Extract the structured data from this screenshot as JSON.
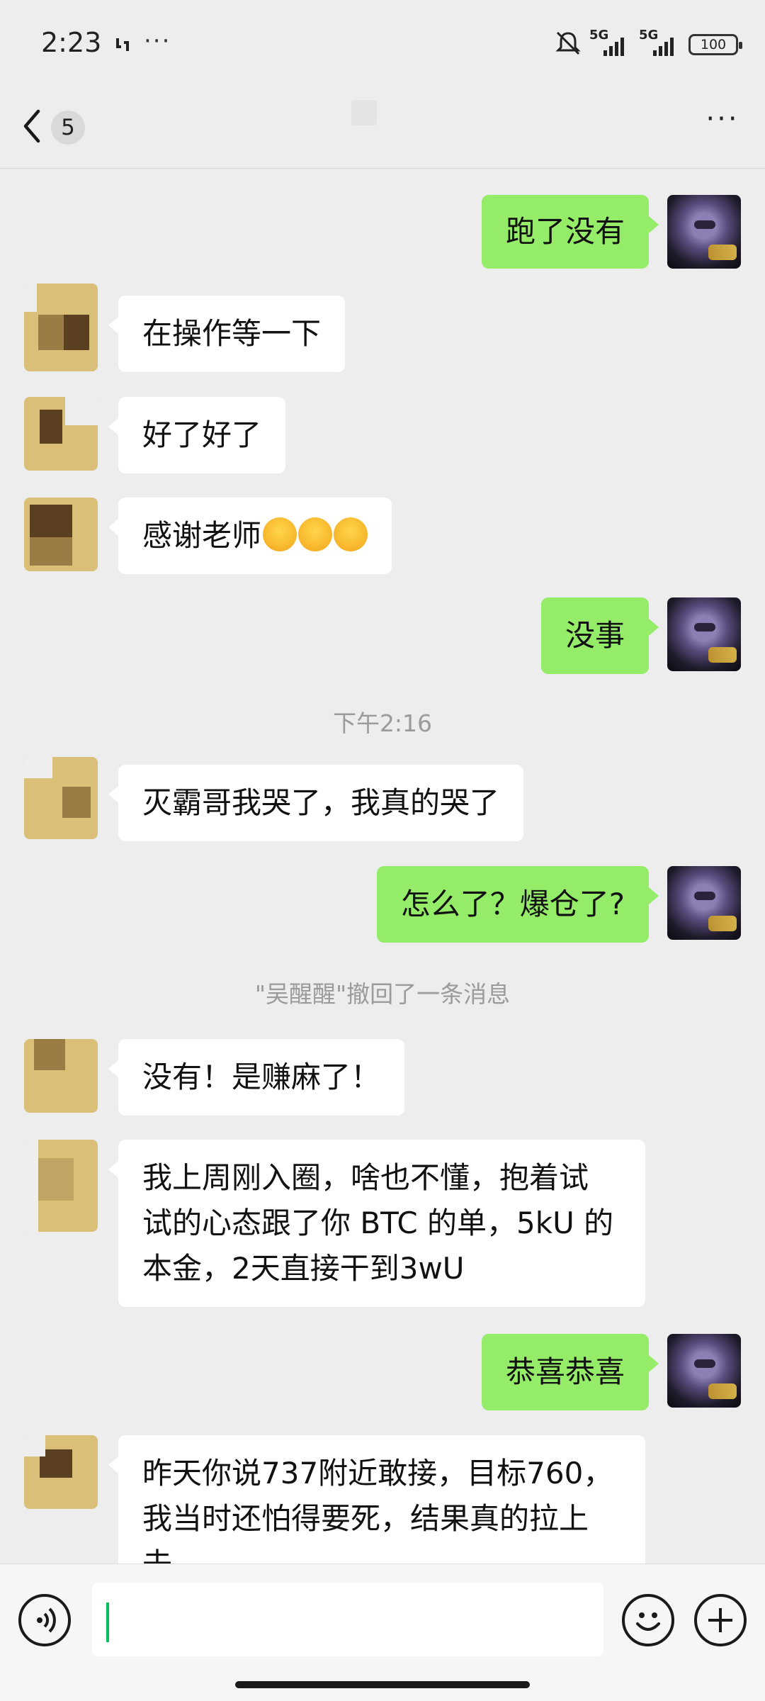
{
  "status_bar": {
    "time": "2:23",
    "more": "···",
    "signal1": "5G",
    "signal2": "5G",
    "battery": "100"
  },
  "header": {
    "unread_count": "5",
    "more": "···"
  },
  "messages": [
    {
      "from": "me",
      "text": "跑了没有"
    },
    {
      "from": "them",
      "text": "在操作等一下"
    },
    {
      "from": "them",
      "text": "好了好了"
    },
    {
      "from": "them",
      "text": "感谢老师"
    },
    {
      "from": "me",
      "text": "没事"
    },
    {
      "type": "time",
      "text": "下午2:16"
    },
    {
      "from": "them",
      "text": "灭霸哥我哭了，我真的哭了"
    },
    {
      "from": "me",
      "text": "怎么了？爆仓了?"
    },
    {
      "type": "system",
      "text": "\"吴醒醒\"撤回了一条消息"
    },
    {
      "from": "them",
      "text": "没有！是赚麻了！"
    },
    {
      "from": "them",
      "lines": [
        "我上周刚入圈，啥也不懂，抱着试",
        "试的心态跟了你 BTC 的单，5kU 的",
        "本金，2天直接干到3wU"
      ]
    },
    {
      "from": "me",
      "text": "恭喜恭喜"
    },
    {
      "from": "them",
      "lines": [
        "昨天你说737附近敢接，目标760，",
        "我当时还怕得要死，结果真的拉上",
        "去"
      ]
    }
  ],
  "input": {
    "value": "",
    "placeholder": ""
  },
  "icons": [
    "sync-icon",
    "mute-icon",
    "battery-icon",
    "back-icon",
    "more-icon",
    "voice-icon",
    "emoji-icon",
    "plus-icon"
  ],
  "colors": {
    "background": "#ededed",
    "my_bubble": "#95ec69",
    "their_bubble": "#ffffff",
    "caret": "#07c160"
  }
}
